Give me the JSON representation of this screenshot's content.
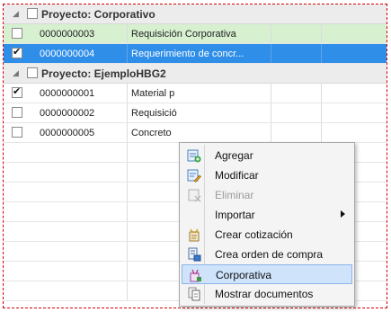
{
  "groups": [
    {
      "title": "Proyecto: Corporativo",
      "rows": [
        {
          "checked": false,
          "id": "0000000003",
          "desc": "Requisición Corporativa",
          "style": "green"
        },
        {
          "checked": true,
          "id": "0000000004",
          "desc": "Requerimiento de concr...",
          "style": "selected"
        }
      ]
    },
    {
      "title": "Proyecto: EjemploHBG2",
      "rows": [
        {
          "checked": true,
          "id": "0000000001",
          "desc": "Material p",
          "c3": "",
          "c4": ""
        },
        {
          "checked": false,
          "id": "0000000002",
          "desc": "Requisició"
        },
        {
          "checked": false,
          "id": "0000000005",
          "desc": "Concreto"
        }
      ]
    }
  ],
  "context_menu": {
    "items": [
      {
        "label": "Agregar",
        "icon": "add-icon",
        "enabled": true
      },
      {
        "label": "Modificar",
        "icon": "edit-icon",
        "enabled": true
      },
      {
        "label": "Eliminar",
        "icon": "delete-icon",
        "enabled": false
      },
      {
        "label": "Importar",
        "icon": "",
        "enabled": true,
        "submenu": true
      },
      {
        "label": "Crear cotización",
        "icon": "quote-icon",
        "enabled": true
      },
      {
        "label": "Crea orden de compra",
        "icon": "purchase-order-icon",
        "enabled": true
      },
      {
        "label": "Corporativa",
        "icon": "corporate-icon",
        "enabled": true,
        "highlighted": true
      },
      {
        "label": "Mostrar documentos",
        "icon": "documents-icon",
        "enabled": true
      }
    ]
  },
  "colors": {
    "selection": "#2f8ee8",
    "green_row": "#d7f0d0",
    "group_header": "#ececec",
    "frame_border": "#d40000",
    "menu_highlight": "#cfe3fb"
  }
}
